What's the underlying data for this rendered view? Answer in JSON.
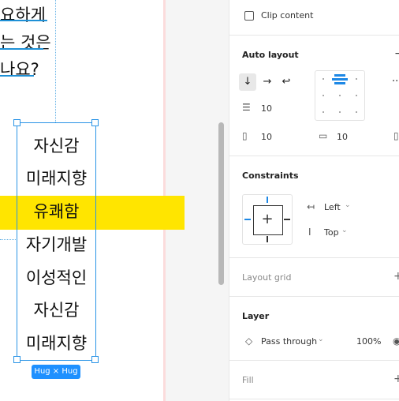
{
  "canvas": {
    "lines": [
      "요하게",
      "는 것은",
      "나요?"
    ],
    "words": [
      "자신감",
      "미래지향",
      "유쾌함",
      "자기개발",
      "이성적인",
      "자신감",
      "미래지향"
    ],
    "hug_badge": "Hug × Hug"
  },
  "panel": {
    "clip_content": "Clip content",
    "auto_layout": {
      "title": "Auto layout",
      "remove": "−",
      "spacing": "10",
      "padding_h": "10",
      "padding_v": "10"
    },
    "constraints": {
      "title": "Constraints",
      "horizontal": "Left",
      "vertical": "Top"
    },
    "layout_grid": {
      "title": "Layout grid",
      "add": "+"
    },
    "layer": {
      "title": "Layer",
      "blend": "Pass through",
      "opacity": "100%"
    },
    "fill": {
      "title": "Fill",
      "add": "+"
    }
  },
  "colors": {
    "selection": "#2a94e6",
    "highlight": "#ffe500",
    "accent": "#1e88e5"
  }
}
